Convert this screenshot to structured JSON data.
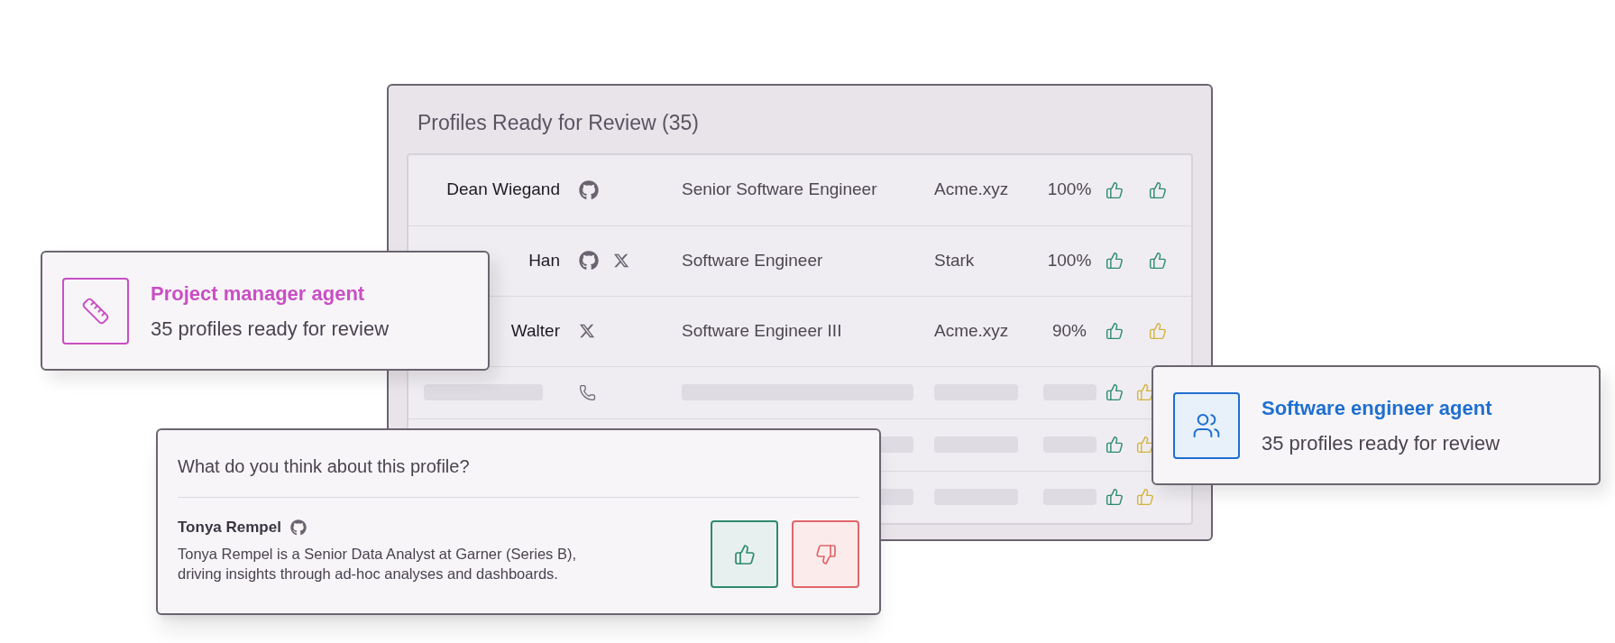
{
  "review_panel": {
    "title": "Profiles Ready for Review (35)",
    "rows": [
      {
        "kind": "profile",
        "name": "Dean Wiegand",
        "links": [
          {
            "kind": "github"
          }
        ],
        "title": "Senior Software Engineer",
        "company": "Acme.xyz",
        "match": "100%",
        "thumbs": [
          {
            "color": "#2e8a6e"
          },
          {
            "color": "#2e8a6e"
          }
        ]
      },
      {
        "kind": "profile",
        "name": "Han",
        "links": [
          {
            "kind": "github"
          },
          {
            "kind": "x"
          }
        ],
        "title": "Software Engineer",
        "company": "Stark",
        "match": "100%",
        "thumbs": [
          {
            "color": "#2e8a6e"
          },
          {
            "color": "#2e8a6e"
          }
        ]
      },
      {
        "kind": "profile",
        "name": "Walter",
        "links": [
          {
            "kind": "x"
          }
        ],
        "title": "Software Engineer III",
        "company": "Acme.xyz",
        "match": "90%",
        "thumbs": [
          {
            "color": "#2e8a6e"
          },
          {
            "color": "#d4b33e"
          }
        ]
      },
      {
        "kind": "placeholder",
        "bars": [
          {
            "kind": "name"
          },
          {
            "kind": "title"
          },
          {
            "kind": "company"
          },
          {
            "kind": "match"
          }
        ],
        "links": [
          {
            "kind": "phone"
          }
        ],
        "thumbs": [
          {
            "color": "#2e8a6e"
          },
          {
            "color": "#d4b33e"
          }
        ]
      },
      {
        "kind": "placeholder",
        "bars": [
          {
            "kind": "title"
          },
          {
            "kind": "company"
          },
          {
            "kind": "match"
          }
        ],
        "links": [],
        "thumbs": [
          {
            "color": "#2e8a6e"
          },
          {
            "color": "#d4b33e"
          }
        ]
      },
      {
        "kind": "placeholder",
        "bars": [
          {
            "kind": "title"
          },
          {
            "kind": "company"
          },
          {
            "kind": "match"
          }
        ],
        "links": [],
        "thumbs": [
          {
            "color": "#2e8a6e"
          },
          {
            "color": "#d4b33e"
          }
        ]
      }
    ]
  },
  "agent_cards": [
    {
      "kind": "ruler",
      "title": "Project manager agent",
      "subtitle": "35 profiles ready for review",
      "color": "#c94fc4"
    },
    {
      "kind": "users",
      "title": "Software engineer agent",
      "subtitle": "35 profiles ready for review",
      "color": "#1f6fcf"
    }
  ],
  "feedback_card": {
    "question": "What do you think about this profile?",
    "name": "Tonya Rempel",
    "links": [
      {
        "kind": "github"
      }
    ],
    "description": "Tonya Rempel is a Senior Data Analyst at Garner (Series B), driving insights through ad-hoc analyses and dashboards.",
    "buttons": [
      {
        "kind": "up"
      },
      {
        "kind": "down"
      }
    ]
  }
}
